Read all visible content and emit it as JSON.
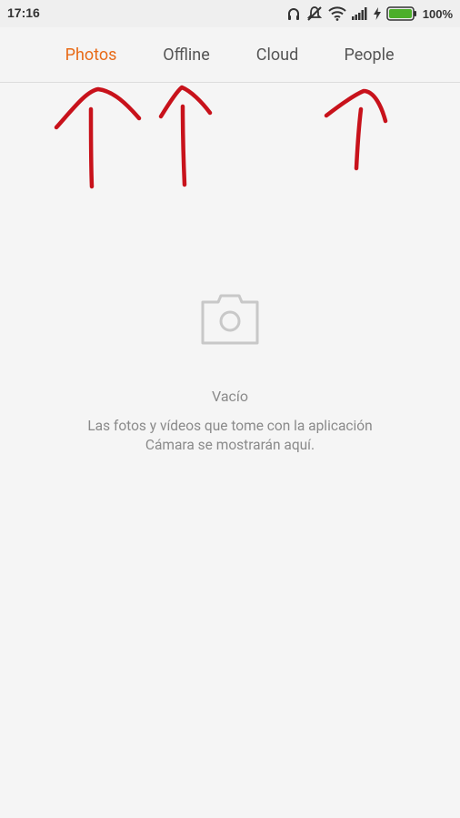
{
  "status_bar": {
    "time": "17:16",
    "battery_percent": "100%",
    "icons": [
      "headphones-icon",
      "mute-icon",
      "wifi-icon",
      "signal-icon",
      "charging-icon",
      "battery-icon"
    ]
  },
  "tabs": [
    {
      "label": "Photos",
      "active": true
    },
    {
      "label": "Offline",
      "active": false
    },
    {
      "label": "Cloud",
      "active": false
    },
    {
      "label": "People",
      "active": false
    }
  ],
  "empty_state": {
    "icon": "camera-icon",
    "title": "Vacío",
    "line1": "Las fotos y vídeos que tome con la aplicación",
    "line2": "Cámara se mostrarán aquí."
  },
  "colors": {
    "accent": "#e86a17",
    "annotation": "#c8121b",
    "battery": "#4caf2a"
  }
}
